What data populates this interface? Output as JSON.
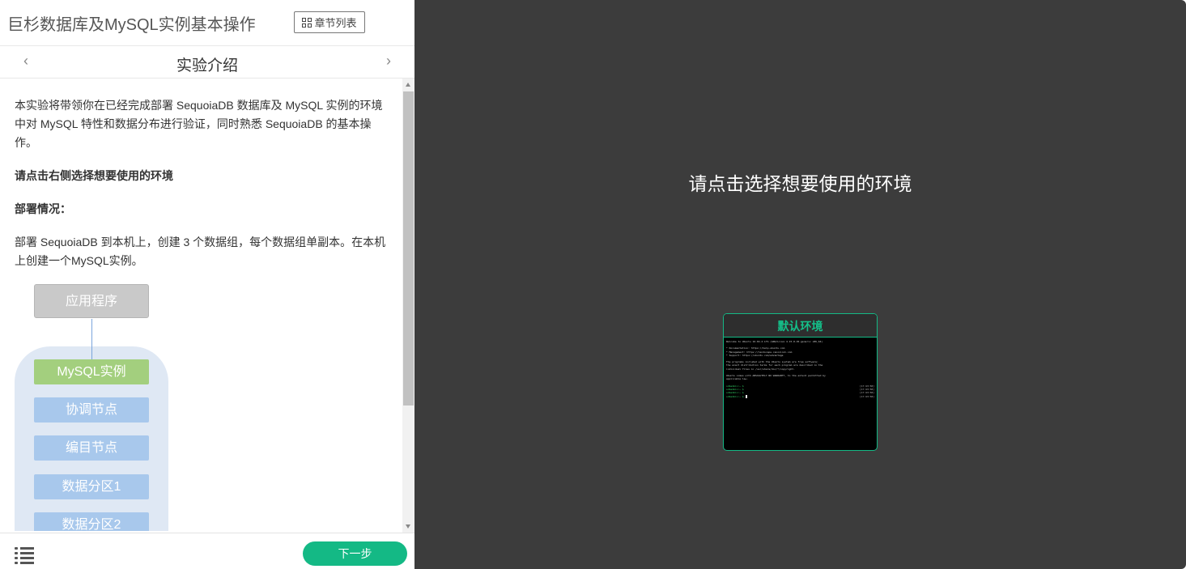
{
  "header": {
    "course_title": "巨杉数据库及MySQL实例基本操作",
    "chapter_list_label": "章节列表"
  },
  "nav": {
    "prev_label": "‹",
    "section_title": "实验介绍",
    "next_label": "›"
  },
  "content": {
    "intro": "本实验将带领你在已经完成部署 SequoiaDB 数据库及 MySQL 实例的环境中对 MySQL 特性和数据分布进行验证，同时熟悉 SequoiaDB 的基本操作。",
    "choose_env_hint": "请点击右侧选择想要使用的环境",
    "deploy_heading": "部署情况：",
    "deploy_text": "部署 SequoiaDB 到本机上，创建 3 个数据组，每个数据组单副本。在本机上创建一个MySQL实例。"
  },
  "diagram": {
    "app": "应用程序",
    "mysql": "MySQL实例",
    "coord": "协调节点",
    "catalog": "编目节点",
    "partition1": "数据分区1",
    "partition2": "数据分区2"
  },
  "footer": {
    "next_button": "下一步"
  },
  "env": {
    "prompt": "请点击选择想要使用的环境",
    "card_title": "默认环境",
    "terminal": {
      "welcome": "Welcome to Ubuntu 16.04.4 LTS (GNU/Linux 4.15.0-45-generic x86_64)",
      "doc": " * Documentation:  https://help.ubuntu.com",
      "mgmt": " * Management:     https://landscape.canonical.com",
      "support": " * Support:        https://ubuntu.com/advantage",
      "free1": "The programs included with the Ubuntu system are free software;",
      "free2": "the exact distribution terms for each program are described in the",
      "free3": "individual files in /usr/share/doc/*/copyright.",
      "warranty1": "Ubuntu comes with ABSOLUTELY NO WARRANTY, to the extent permitted by",
      "warranty2": "applicable law.",
      "prompt1": "sdbadmin:~ $",
      "prompt2": "sdbadmin:~ $",
      "prompt3": "sdbadmin:~ $",
      "prompt4": "sdbadmin:~ $",
      "time1": "[17:43:58]",
      "time2": "[17:43:58]",
      "time3": "[17:43:58]",
      "time4": "[17:43:58]"
    }
  },
  "colors": {
    "accent": "#14b985",
    "right_bg": "#3c3c3c"
  }
}
